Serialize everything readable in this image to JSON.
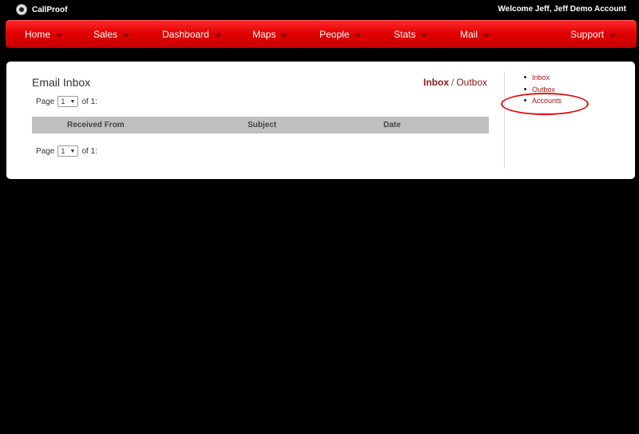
{
  "app": {
    "name": "CallProof",
    "welcome": "Welcome Jeff, Jeff Demo Account"
  },
  "nav": {
    "items": [
      {
        "label": "Home"
      },
      {
        "label": "Sales"
      },
      {
        "label": "Dashboard"
      },
      {
        "label": "Maps"
      },
      {
        "label": "People"
      },
      {
        "label": "Stats"
      },
      {
        "label": "Mail"
      },
      {
        "label": "Support"
      }
    ]
  },
  "main": {
    "title": "Email Inbox",
    "box_inbox": "Inbox",
    "box_sep": "/",
    "box_outbox": "Outbox",
    "pager": {
      "label": "Page",
      "selected": "1",
      "of": "of 1:"
    },
    "table": {
      "columns": [
        "Received From",
        "Subject",
        "Date"
      ]
    }
  },
  "sidebar": {
    "links": [
      "Inbox",
      "Outbox",
      "Accounts"
    ]
  },
  "colors": {
    "nav_red": "#e00000",
    "link": "#a0161a",
    "annotation": "#e01010"
  }
}
